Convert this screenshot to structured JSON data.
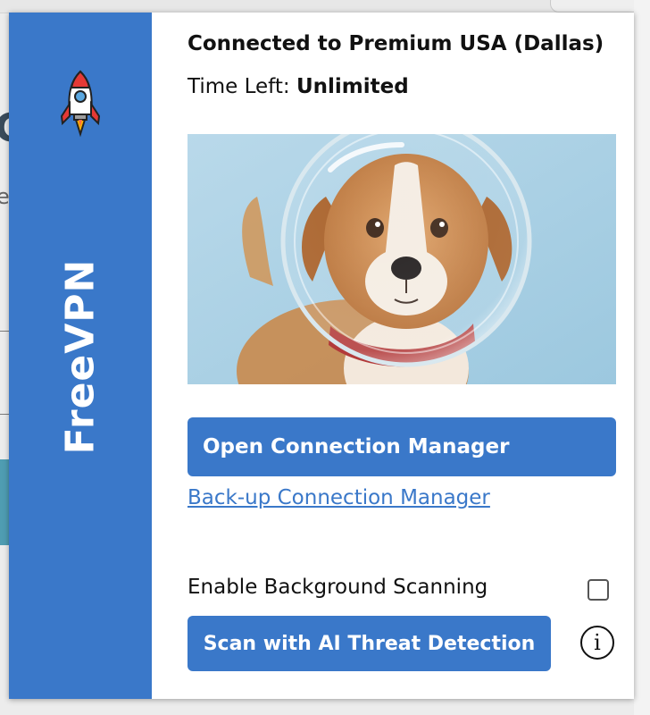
{
  "sidebar": {
    "brand": "FreeVPN",
    "logo_icon": "rocket-icon"
  },
  "status": {
    "connected_text": "Connected to Premium USA (Dallas)",
    "time_left_label": "Time Left:",
    "time_left_value": "Unlimited"
  },
  "hero": {
    "image": "dog-in-astronaut-helmet"
  },
  "actions": {
    "open_manager_label": "Open Connection Manager",
    "backup_manager_label": "Back-up Connection Manager",
    "scan_option_label": "Enable Background Scanning",
    "scan_option_checked": false,
    "scan_button_label": "Scan with AI Threat Detection",
    "info_icon": "info-icon"
  },
  "colors": {
    "accent": "#3a78c9"
  }
}
